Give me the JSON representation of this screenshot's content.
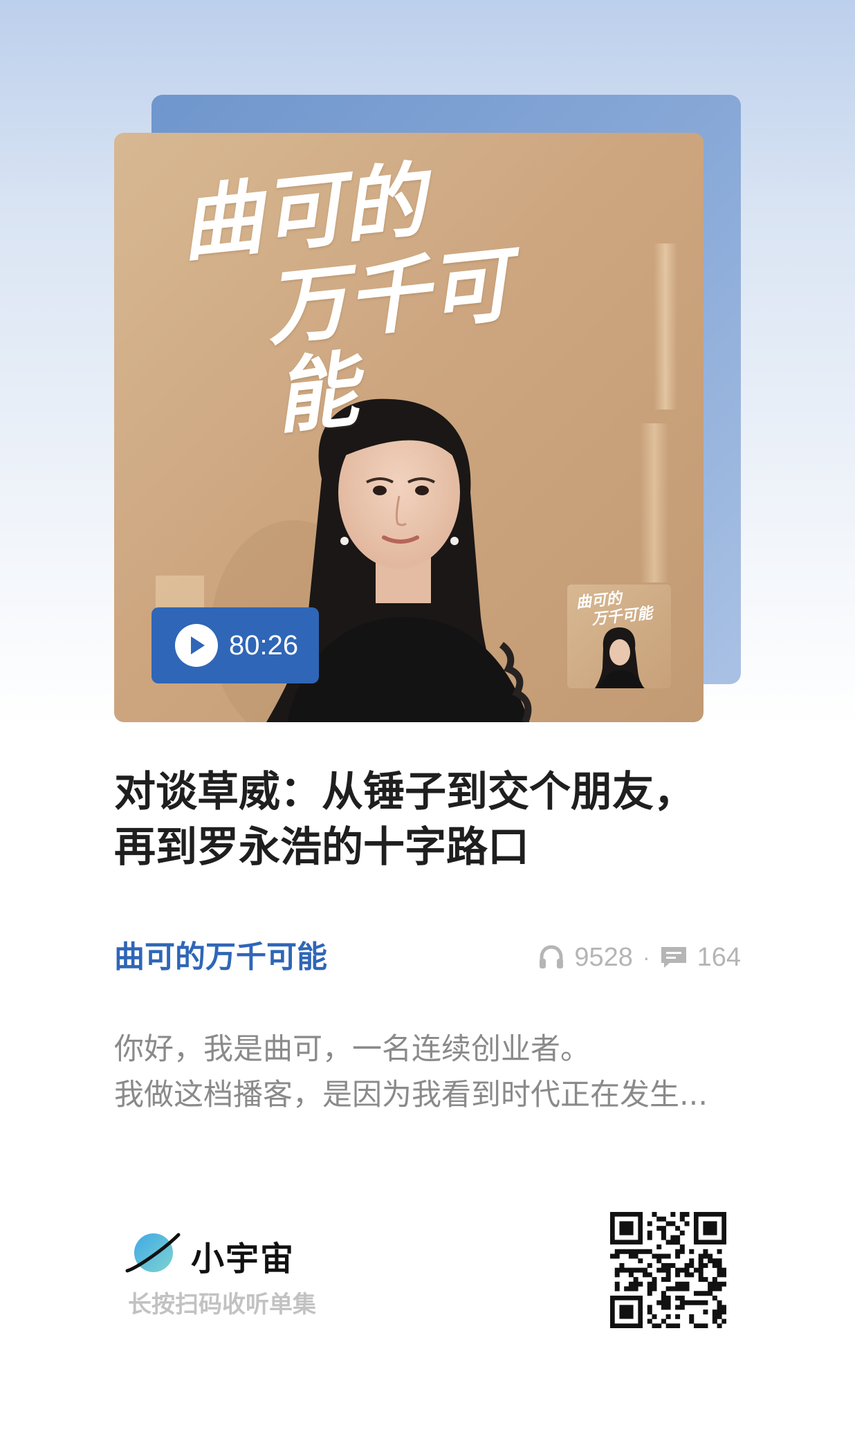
{
  "cover": {
    "title_line1": "曲可的",
    "title_line2": "万千可能",
    "duration": "80:26",
    "thumb_line1": "曲可的",
    "thumb_line2": "万千可能"
  },
  "episode": {
    "title": "对谈草威：从锤子到交个朋友，再到罗永浩的十字路口"
  },
  "show": {
    "name": "曲可的万千可能"
  },
  "stats": {
    "plays": "9528",
    "separator": "·",
    "comments": "164",
    "plays_icon": "headphones-icon",
    "comments_icon": "comment-icon"
  },
  "description": {
    "line1": "你好，我是曲可，一名连续创业者。",
    "line2": "我做这档播客，是因为我看到时代正在发生..."
  },
  "brand": {
    "name": "小宇宙",
    "logo_icon": "planet-logo-icon",
    "scan_hint": "长按扫码收听单集"
  },
  "colors": {
    "accent": "#2f66b7",
    "title_text": "#1f1f1f",
    "muted_text": "#8a8a8a",
    "stats_text": "#b5b5b5"
  }
}
